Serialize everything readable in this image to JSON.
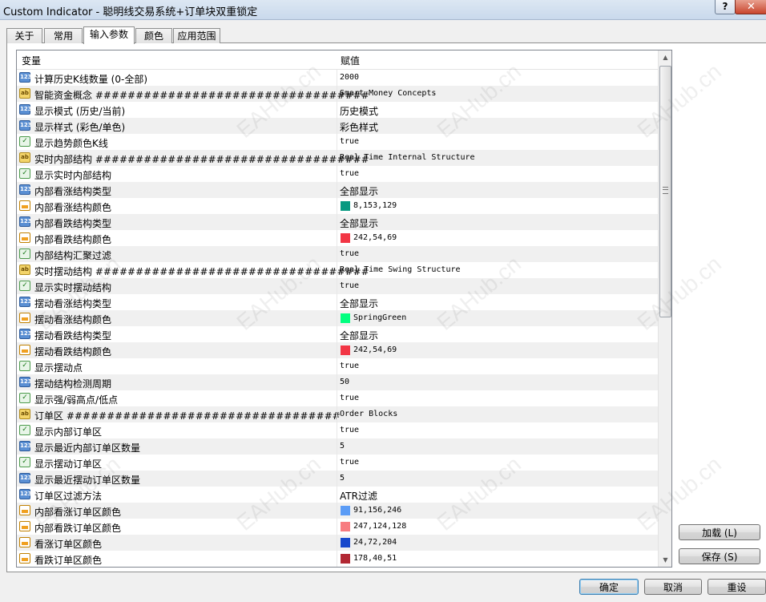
{
  "window": {
    "title": "Custom Indicator - 聪明线交易系统+订单块双重锁定",
    "help": "?",
    "close": "✕"
  },
  "tabs": [
    {
      "label": "关于"
    },
    {
      "label": "常用"
    },
    {
      "label": "输入参数",
      "active": true
    },
    {
      "label": "颜色"
    },
    {
      "label": "应用范围"
    }
  ],
  "grid": {
    "headers": {
      "name": "变量",
      "value": "赋值"
    },
    "rows": [
      {
        "type": "int",
        "name": "计算历史K线数量 (0-全部)",
        "value": "2000"
      },
      {
        "type": "str",
        "name": "智能资金概念 ##################################",
        "value": "Smart Money Concepts"
      },
      {
        "type": "int",
        "name": "显示模式 (历史/当前)",
        "value": "历史模式"
      },
      {
        "type": "int",
        "name": "显示样式 (彩色/单色)",
        "value": "彩色样式"
      },
      {
        "type": "bool",
        "name": "显示趋势颜色K线",
        "value": "true"
      },
      {
        "type": "str",
        "name": "实时内部结构 ##################################",
        "value": "Real Time Internal Structure"
      },
      {
        "type": "bool",
        "name": "显示实时内部结构",
        "value": "true"
      },
      {
        "type": "int",
        "name": "内部看涨结构类型",
        "value": "全部显示"
      },
      {
        "type": "color",
        "name": "内部看涨结构颜色",
        "value": "8,153,129",
        "swatch": "#089981"
      },
      {
        "type": "int",
        "name": "内部看跌结构类型",
        "value": "全部显示"
      },
      {
        "type": "color",
        "name": "内部看跌结构颜色",
        "value": "242,54,69",
        "swatch": "#f23645"
      },
      {
        "type": "bool",
        "name": "内部结构汇聚过滤",
        "value": "true"
      },
      {
        "type": "str",
        "name": "实时摆动结构 ##################################",
        "value": "Real Time Swing Structure"
      },
      {
        "type": "bool",
        "name": "显示实时摆动结构",
        "value": "true"
      },
      {
        "type": "int",
        "name": "摆动看涨结构类型",
        "value": "全部显示"
      },
      {
        "type": "color",
        "name": "摆动看涨结构颜色",
        "value": "SpringGreen",
        "swatch": "#00ff7f"
      },
      {
        "type": "int",
        "name": "摆动看跌结构类型",
        "value": "全部显示"
      },
      {
        "type": "color",
        "name": "摆动看跌结构颜色",
        "value": "242,54,69",
        "swatch": "#f23645"
      },
      {
        "type": "bool",
        "name": "显示摆动点",
        "value": "true"
      },
      {
        "type": "int",
        "name": "摆动结构检测周期",
        "value": "50"
      },
      {
        "type": "bool",
        "name": "显示强/弱高点/低点",
        "value": "true"
      },
      {
        "type": "str",
        "name": "订单区 ##################################",
        "value": "Order Blocks"
      },
      {
        "type": "bool",
        "name": "显示内部订单区",
        "value": "true"
      },
      {
        "type": "int",
        "name": "显示最近内部订单区数量",
        "value": "5"
      },
      {
        "type": "bool",
        "name": "显示摆动订单区",
        "value": "true"
      },
      {
        "type": "int",
        "name": "显示最近摆动订单区数量",
        "value": "5"
      },
      {
        "type": "int",
        "name": "订单区过滤方法",
        "value": "ATR过滤"
      },
      {
        "type": "color",
        "name": "内部看涨订单区颜色",
        "value": "91,156,246",
        "swatch": "#5b9cf6"
      },
      {
        "type": "color",
        "name": "内部看跌订单区颜色",
        "value": "247,124,128",
        "swatch": "#f77c80"
      },
      {
        "type": "color",
        "name": "看涨订单区颜色",
        "value": "24,72,204",
        "swatch": "#1848cc"
      },
      {
        "type": "color",
        "name": "看跌订单区颜色",
        "value": "178,40,51",
        "swatch": "#b22833"
      }
    ]
  },
  "icons": {
    "int": "123",
    "str": "ab",
    "bool": "✓",
    "color": ""
  },
  "buttons": {
    "load": "加载 (L)",
    "save": "保存 (S)",
    "ok": "确定",
    "cancel": "取消",
    "reset": "重设"
  },
  "watermark": "EAHub.cn"
}
